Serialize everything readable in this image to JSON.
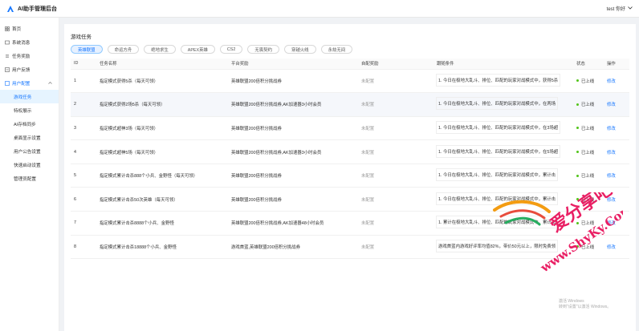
{
  "header": {
    "title": "AI助手管理后台",
    "user": "test 你好"
  },
  "sidebar": {
    "items": [
      {
        "label": "首页",
        "icon": "home-icon"
      },
      {
        "label": "系统消息",
        "icon": "message-icon"
      },
      {
        "label": "任务奖励",
        "icon": "task-icon"
      },
      {
        "label": "用户反馈",
        "icon": "feedback-icon"
      }
    ],
    "group": {
      "label": "用户配置",
      "icon": "user-config-icon",
      "children": [
        "游戏任务",
        "特权展示",
        "AI存档同步",
        "桌面显示设置",
        "用户公告设置",
        "快速启动设置",
        "管理员配置"
      ]
    }
  },
  "panel": {
    "title": "游戏任务",
    "tabs": [
      "英雄联盟",
      "命运方舟",
      "绝地求生",
      "APEX英雄",
      "CS2",
      "无畏契约",
      "穿越火线",
      "永劫无间"
    ],
    "columns": [
      "ID",
      "任务名称",
      "平台奖励",
      "自配奖励",
      "跟随条件",
      "状态",
      "操作"
    ],
    "rows": [
      {
        "id": "1",
        "name": "指定模式获得5杀（每天可领）",
        "reward": "英雄联盟200倍积分挑战券",
        "self": "未配置",
        "cond": "1. 今日在极地大乱斗、排位、匹配的玩家对战模式中，获得5杀",
        "status": "已上线",
        "op": "修改"
      },
      {
        "id": "2",
        "name": "指定模式获得2场5杀（每天可领）",
        "reward": "英雄联盟200倍积分挑战券,AK加速器3小时会员",
        "self": "未配置",
        "cond": "1. 今日在极地大乱斗、排位、匹配的玩家对战模式中，在两场",
        "status": "已上线",
        "op": "修改"
      },
      {
        "id": "3",
        "name": "指定模式超神3场（每天可领）",
        "reward": "英雄联盟200倍积分挑战券",
        "self": "未配置",
        "cond": "1. 今日在极地大乱斗、排位、匹配的玩家对战模式中，在3场超",
        "status": "已上线",
        "op": "修改"
      },
      {
        "id": "4",
        "name": "指定模式超神5场（每天可领）",
        "reward": "英雄联盟200倍积分挑战券,AK加速器3小时会员",
        "self": "未配置",
        "cond": "1. 今日在极地大乱斗、排位、匹配的玩家对战模式中，在5场超",
        "status": "已上线",
        "op": "修改"
      },
      {
        "id": "5",
        "name": "指定模式累计击杀888个小兵、金野怪（每天可领）",
        "reward": "英雄联盟200倍积分挑战券",
        "self": "未配置",
        "cond": "1. 今日在极地大乱斗、排位、匹配的玩家对战模式中，累计击",
        "status": "已上线",
        "op": "修改"
      },
      {
        "id": "6",
        "name": "指定模式累计击杀50次英雄（每天可领）",
        "reward": "英雄联盟200倍积分挑战券",
        "self": "未配置",
        "cond": "1. 今日在极地大乱斗、排位、匹配的玩家对战模式中，累计击",
        "status": "已上线",
        "op": "修改"
      },
      {
        "id": "7",
        "name": "指定模式累计击杀8888个小兵、金野怪",
        "reward": "英雄联盟200倍积分挑战券,AK加速器48小时会员",
        "self": "未配置",
        "cond": "1. 累计在极地大乱斗、排位、匹配的玩家对战模式中，累计击",
        "status": "已上线",
        "op": "修改"
      },
      {
        "id": "8",
        "name": "指定模式累计击杀18888个小兵、金野怪",
        "reward": "游戏首蓝,英雄联盟200倍积分挑战券",
        "self": "未配置",
        "cond": "游戏首蓝内游戏好评率均值82%，带价50元以上，限时免费领",
        "status": "已上线",
        "op": "修改"
      }
    ]
  },
  "overlay": {
    "watermark_text": "www.ShyKy.Com",
    "watermark_brand": "爱分享吧",
    "windows_line1": "激活 Windows",
    "windows_line2": "转到\"设置\"以激活 Windows。"
  },
  "colors": {
    "accent": "#1677ff",
    "online": "#52c41a"
  }
}
